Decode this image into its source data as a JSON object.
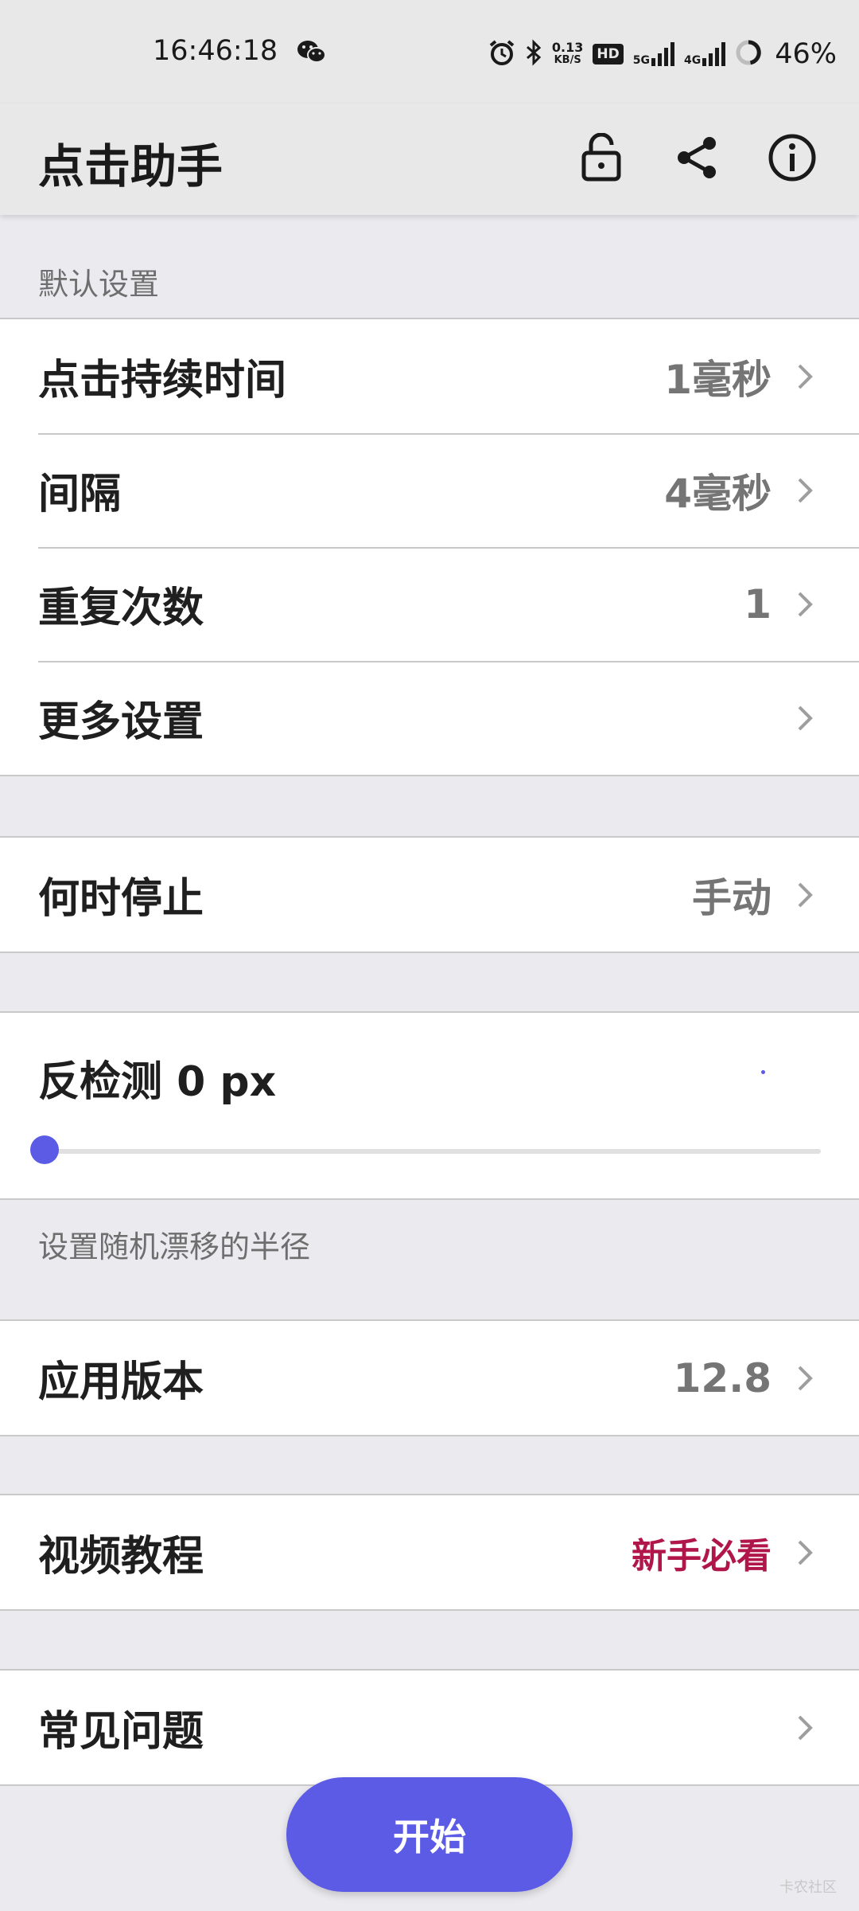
{
  "status_bar": {
    "time": "16:46:18",
    "net_speed_value": "0.13",
    "net_speed_unit": "KB/S",
    "hd_label": "HD",
    "sig1_label": "5G",
    "sig2_label": "4G",
    "battery": "46%"
  },
  "app_bar": {
    "title": "点击助手"
  },
  "sections": {
    "default_header": "默认设置",
    "slider_caption": "设置随机漂移的半径"
  },
  "default_settings": [
    {
      "label": "点击持续时间",
      "value": "1毫秒"
    },
    {
      "label": "间隔",
      "value": "4毫秒"
    },
    {
      "label": "重复次数",
      "value": "1"
    },
    {
      "label": "更多设置",
      "value": ""
    }
  ],
  "stop": {
    "label": "何时停止",
    "value": "手动"
  },
  "anti_detect": {
    "label": "反检测 0 px",
    "level_fraction": 0
  },
  "version": {
    "label": "应用版本",
    "value": "12.8"
  },
  "tutorial": {
    "label": "视频教程",
    "value": "新手必看"
  },
  "faq": {
    "label": "常见问题",
    "value": ""
  },
  "fab": {
    "label": "开始"
  },
  "watermark": "卡农社区",
  "colors": {
    "accent": "#5b5be6",
    "highlight": "#b0164a",
    "background": "#ebebef"
  }
}
